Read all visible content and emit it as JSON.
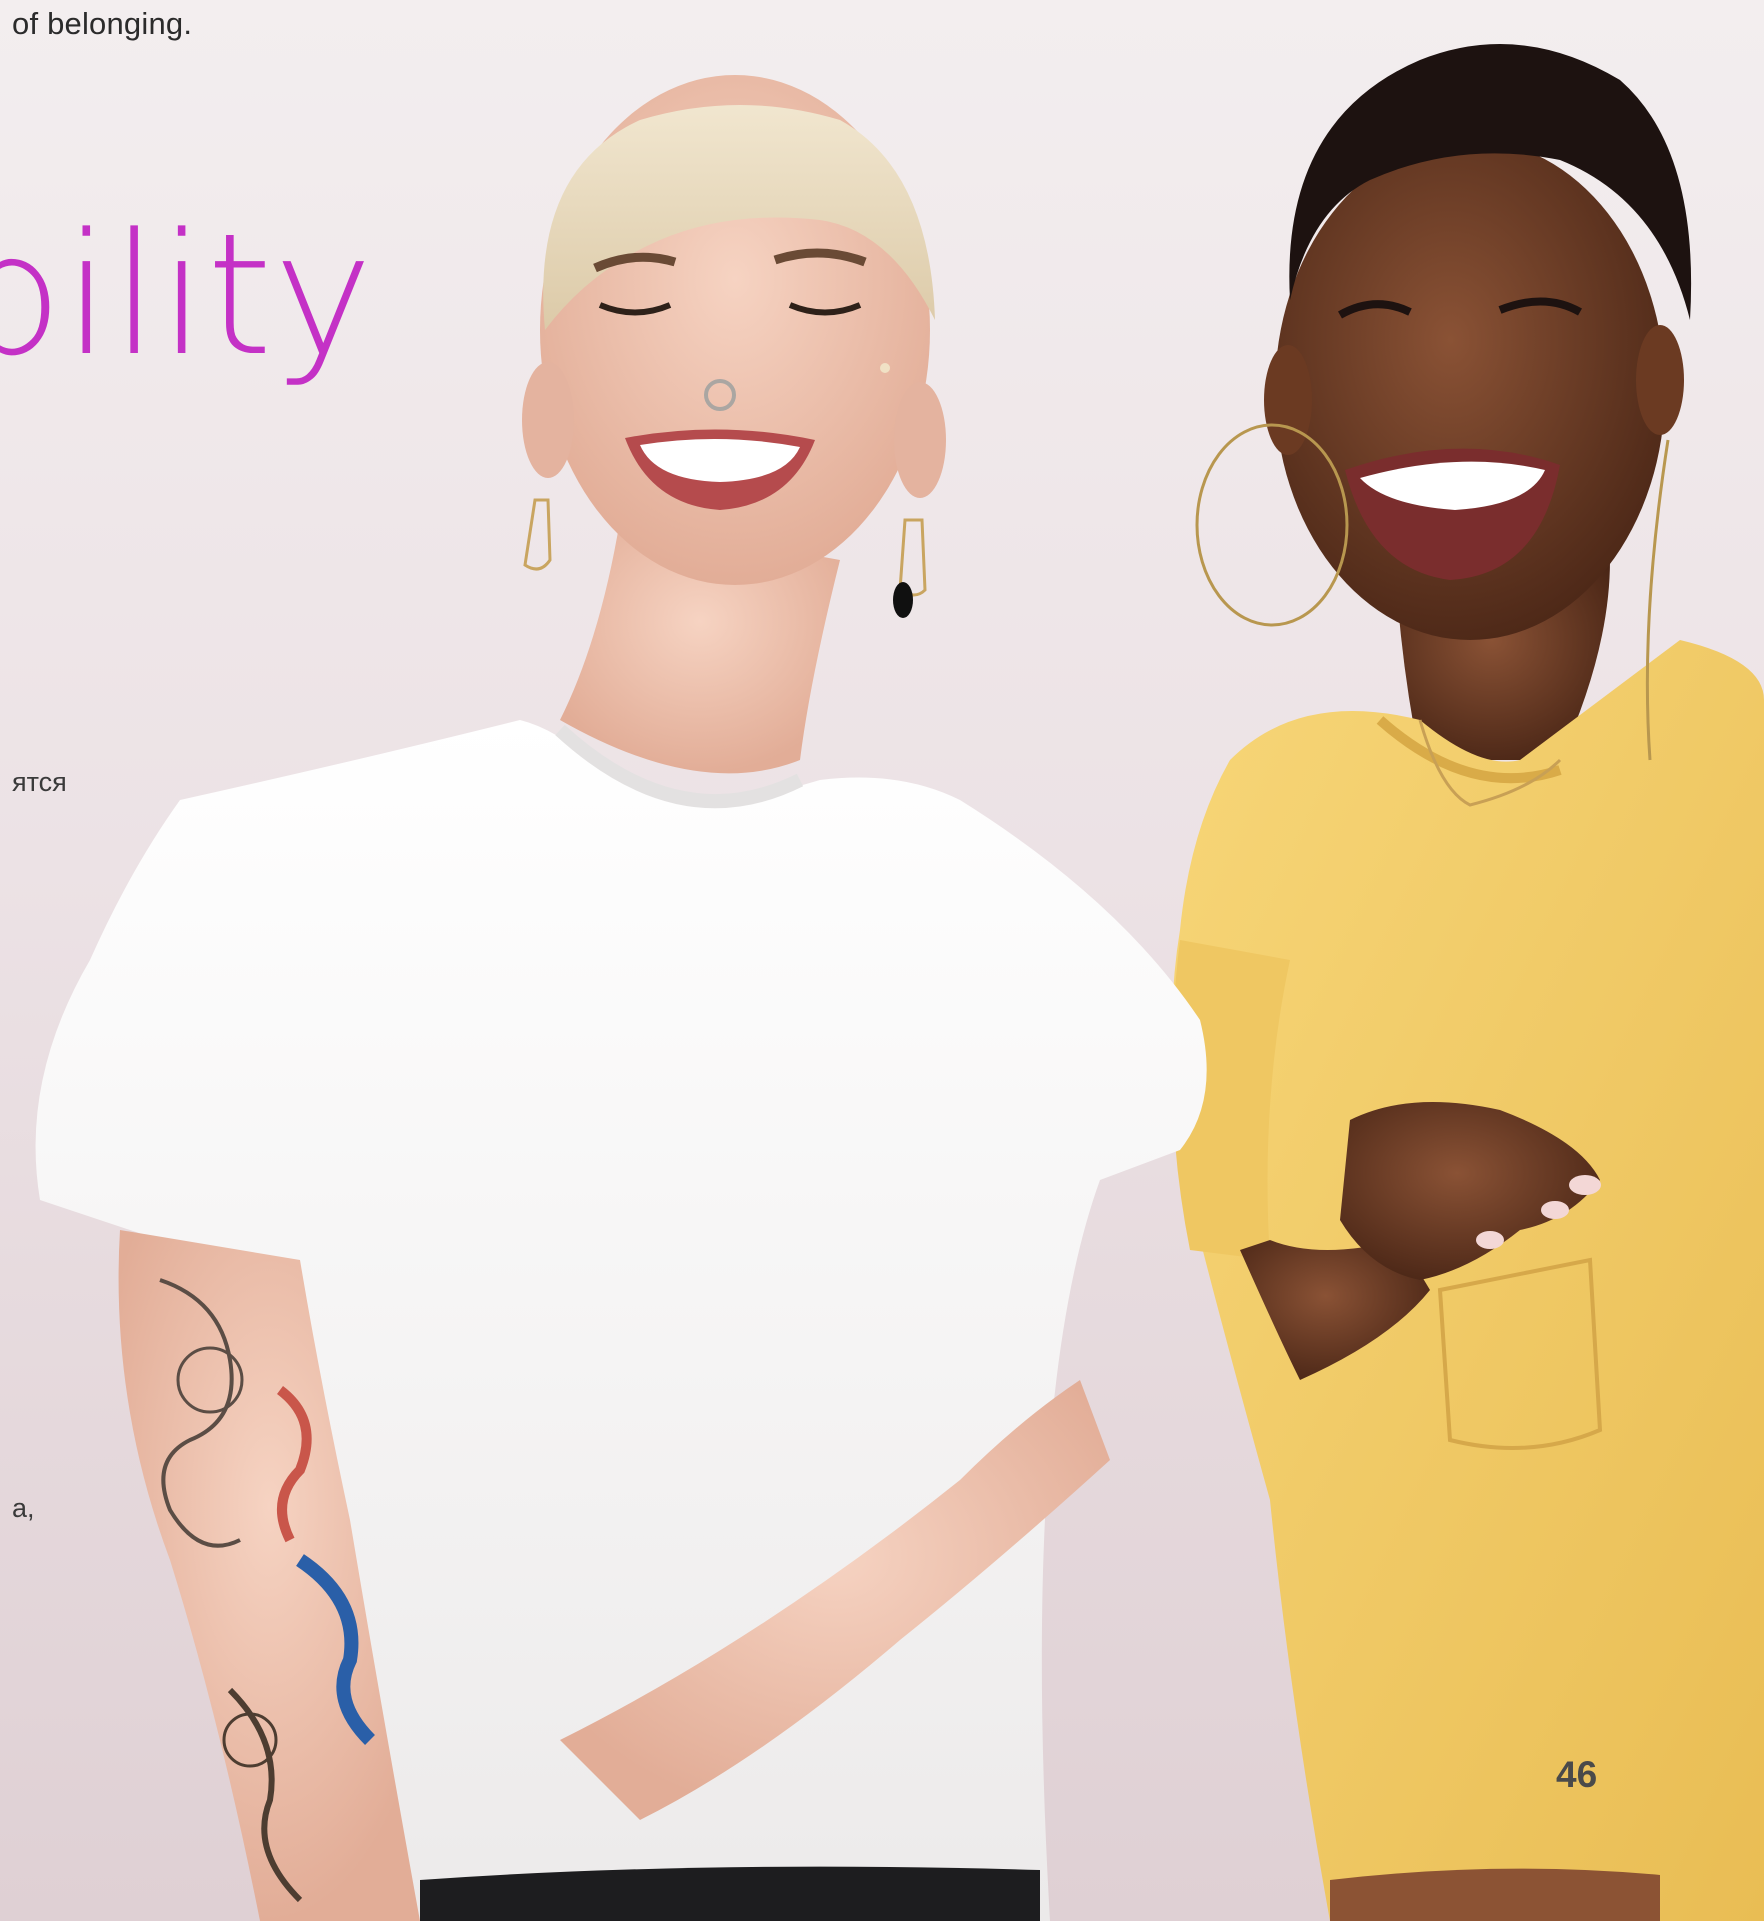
{
  "text": {
    "top_snippet": "of belonging.",
    "headline": "bility",
    "cyrillic_snippet_1": "ятся",
    "cyrillic_snippet_2": "а,"
  },
  "page": {
    "number": "46"
  },
  "colors": {
    "accent_headline": "#c431c6",
    "background_top": "#f3eeef",
    "background_bottom": "#dfd0d4",
    "body_text": "#2b2b2b",
    "page_number": "#4a4a4a"
  },
  "photo": {
    "subject": "two smiling women",
    "shirts": [
      "white t-shirt",
      "yellow t-shirt"
    ]
  }
}
